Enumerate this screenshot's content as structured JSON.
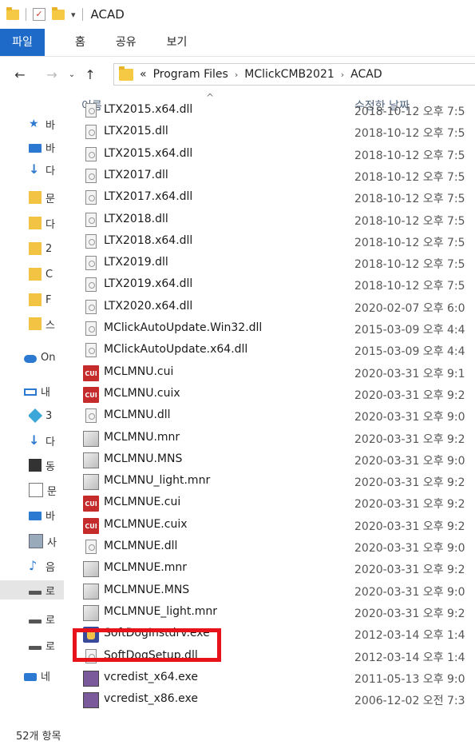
{
  "window": {
    "title": "ACAD"
  },
  "ribbon": {
    "tabs": [
      "파일",
      "홈",
      "공유",
      "보기"
    ]
  },
  "address": {
    "overflow": "«",
    "crumbs": [
      "Program Files",
      "MClickCMB2021",
      "ACAD"
    ]
  },
  "sidebar": {
    "items": [
      {
        "label": "바",
        "icon": "pin-icon"
      },
      {
        "label": "바",
        "icon": "desktop-icon"
      },
      {
        "label": "다",
        "icon": "download-icon"
      },
      {
        "label": "문",
        "icon": "documents-icon"
      },
      {
        "label": "다",
        "icon": "documents-icon"
      },
      {
        "label": "2",
        "icon": "folder-icon"
      },
      {
        "label": "C",
        "icon": "folder-icon"
      },
      {
        "label": "F",
        "icon": "folder-icon"
      },
      {
        "label": "스",
        "icon": "folder-icon"
      },
      {
        "label": "On",
        "icon": "onedrive-icon"
      },
      {
        "label": "내",
        "icon": "this-pc-icon"
      },
      {
        "label": "3",
        "icon": "3d-objects-icon"
      },
      {
        "label": "다",
        "icon": "download-icon"
      },
      {
        "label": "동",
        "icon": "video-icon"
      },
      {
        "label": "문",
        "icon": "document-icon"
      },
      {
        "label": "바",
        "icon": "desktop-icon"
      },
      {
        "label": "사",
        "icon": "pictures-icon"
      },
      {
        "label": "음",
        "icon": "music-icon"
      },
      {
        "label": "로",
        "icon": "local-disk-icon"
      },
      {
        "label": "로",
        "icon": "drive-icon"
      },
      {
        "label": "로",
        "icon": "drive-icon"
      },
      {
        "label": "네",
        "icon": "network-icon"
      }
    ]
  },
  "columns": {
    "name": "이름",
    "date": "수정한 날짜"
  },
  "files": [
    {
      "name": "LTX2015.x64.dll",
      "date": "2018-10-12 오후 7:5",
      "type": "dll"
    },
    {
      "name": "LTX2015.dll",
      "date": "2018-10-12 오후 7:5",
      "type": "dll"
    },
    {
      "name": "LTX2015.x64.dll",
      "date": "2018-10-12 오후 7:5",
      "type": "dll"
    },
    {
      "name": "LTX2017.dll",
      "date": "2018-10-12 오후 7:5",
      "type": "dll"
    },
    {
      "name": "LTX2017.x64.dll",
      "date": "2018-10-12 오후 7:5",
      "type": "dll"
    },
    {
      "name": "LTX2018.dll",
      "date": "2018-10-12 오후 7:5",
      "type": "dll"
    },
    {
      "name": "LTX2018.x64.dll",
      "date": "2018-10-12 오후 7:5",
      "type": "dll"
    },
    {
      "name": "LTX2019.dll",
      "date": "2018-10-12 오후 7:5",
      "type": "dll"
    },
    {
      "name": "LTX2019.x64.dll",
      "date": "2018-10-12 오후 7:5",
      "type": "dll"
    },
    {
      "name": "LTX2020.x64.dll",
      "date": "2020-02-07 오후 6:0",
      "type": "dll"
    },
    {
      "name": "MClickAutoUpdate.Win32.dll",
      "date": "2015-03-09 오후 4:4",
      "type": "dll"
    },
    {
      "name": "MClickAutoUpdate.x64.dll",
      "date": "2015-03-09 오후 4:4",
      "type": "dll"
    },
    {
      "name": "MCLMNU.cui",
      "date": "2020-03-31 오후 9:1",
      "type": "cui"
    },
    {
      "name": "MCLMNU.cuix",
      "date": "2020-03-31 오후 9:2",
      "type": "cui"
    },
    {
      "name": "MCLMNU.dll",
      "date": "2020-03-31 오후 9:0",
      "type": "dll"
    },
    {
      "name": "MCLMNU.mnr",
      "date": "2020-03-31 오후 9:2",
      "type": "mnr"
    },
    {
      "name": "MCLMNU.MNS",
      "date": "2020-03-31 오후 9:0",
      "type": "mnr"
    },
    {
      "name": "MCLMNU_light.mnr",
      "date": "2020-03-31 오후 9:2",
      "type": "mnr"
    },
    {
      "name": "MCLMNUE.cui",
      "date": "2020-03-31 오후 9:2",
      "type": "cui"
    },
    {
      "name": "MCLMNUE.cuix",
      "date": "2020-03-31 오후 9:2",
      "type": "cui"
    },
    {
      "name": "MCLMNUE.dll",
      "date": "2020-03-31 오후 9:0",
      "type": "dll"
    },
    {
      "name": "MCLMNUE.mnr",
      "date": "2020-03-31 오후 9:2",
      "type": "mnr"
    },
    {
      "name": "MCLMNUE.MNS",
      "date": "2020-03-31 오후 9:0",
      "type": "mnr"
    },
    {
      "name": "MCLMNUE_light.mnr",
      "date": "2020-03-31 오후 9:2",
      "type": "mnr"
    },
    {
      "name": "SoftDogInstdrv.exe",
      "date": "2012-03-14 오후 1:4",
      "type": "exe"
    },
    {
      "name": "SoftDogSetup.dll",
      "date": "2012-03-14 오후 1:4",
      "type": "dll"
    },
    {
      "name": "vcredist_x64.exe",
      "date": "2011-05-13 오후 9:0",
      "type": "vc"
    },
    {
      "name": "vcredist_x86.exe",
      "date": "2006-12-02 오전 7:3",
      "type": "vc"
    }
  ],
  "status": {
    "count": "52개 항목"
  },
  "colors": {
    "accent": "#1e6ac8",
    "highlight": "#e8121a"
  }
}
